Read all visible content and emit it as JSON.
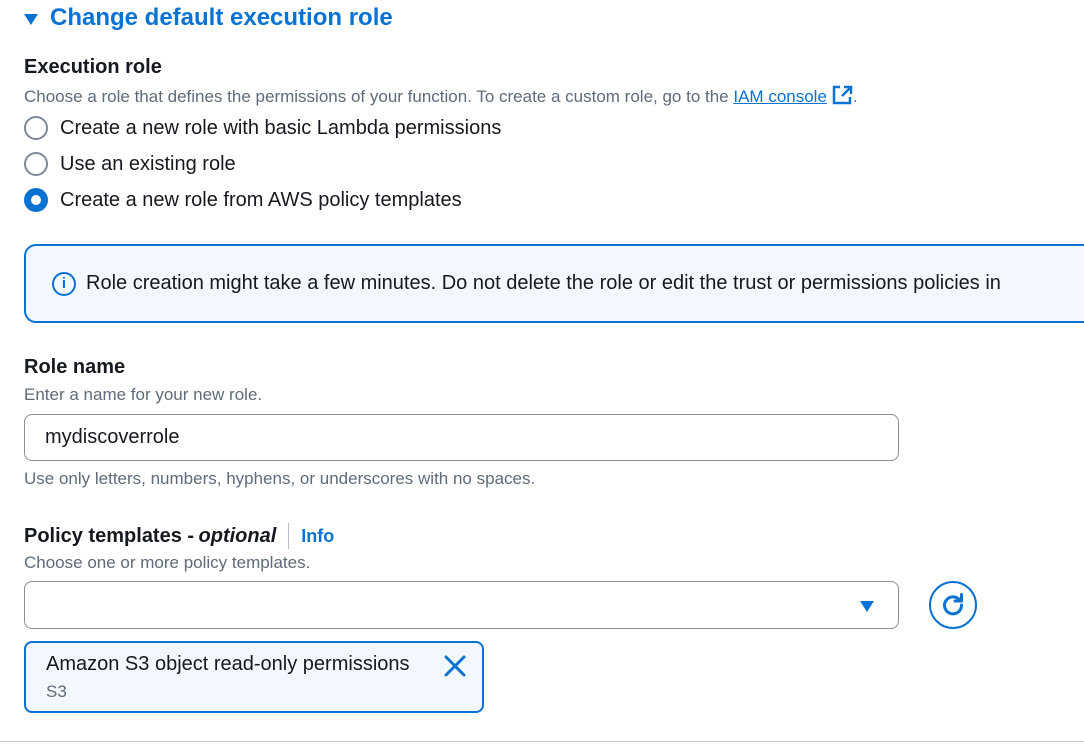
{
  "section": {
    "title": "Change default execution role"
  },
  "execution_role": {
    "label": "Execution role",
    "description_prefix": "Choose a role that defines the permissions of your function. To create a custom role, go to the ",
    "link_text": "IAM console",
    "description_suffix": ".",
    "options": [
      {
        "label": "Create a new role with basic Lambda permissions",
        "checked": false
      },
      {
        "label": "Use an existing role",
        "checked": false
      },
      {
        "label": "Create a new role from AWS policy templates",
        "checked": true
      }
    ]
  },
  "alert": {
    "icon": "info-icon",
    "text": "Role creation might take a few minutes. Do not delete the role or edit the trust or permissions policies in"
  },
  "role_name": {
    "label": "Role name",
    "description": "Enter a name for your new role.",
    "value": "mydiscoverrole",
    "constraint": "Use only letters, numbers, hyphens, or underscores with no spaces."
  },
  "policy_templates": {
    "label_main": "Policy templates - ",
    "label_optional": "optional",
    "info_link": "Info",
    "description": "Choose one or more policy templates.",
    "selected_value": "",
    "tokens": [
      {
        "title": "Amazon S3 object read-only permissions",
        "subtitle": "S3"
      }
    ]
  },
  "colors": {
    "accent": "#0972d3",
    "text": "#16191f",
    "secondary_text": "#5f6b7a"
  }
}
